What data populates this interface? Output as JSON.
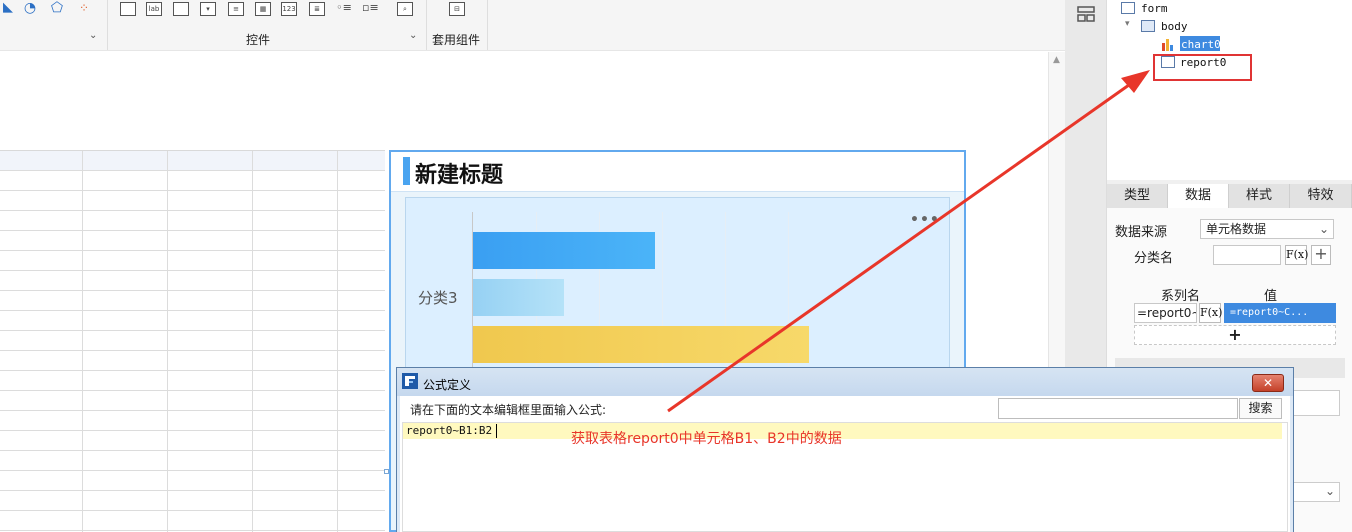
{
  "toolbar": {
    "group_controls_label": "控件",
    "group_common_label": "套用组件",
    "icon_names": [
      "map-chart-icon",
      "gauge-chart-icon",
      "radar-chart-icon",
      "scatter-chart-icon",
      "button-icon",
      "label-icon",
      "textbox-icon",
      "combobox-icon",
      "select-list-icon",
      "date-icon",
      "number-icon",
      "textarea-icon",
      "radio-group-icon",
      "checkbox-group-icon",
      "query-icon",
      "component-icon"
    ]
  },
  "chart": {
    "title": "新建标题",
    "more": "•••",
    "category_label": "分类3"
  },
  "tree": {
    "root": "form",
    "body": "body",
    "chart": "chart0",
    "report": "report0"
  },
  "prop_tabs": [
    "类型",
    "数据",
    "样式",
    "特效"
  ],
  "data_panel": {
    "source_label": "数据来源",
    "source_value": "单元格数据",
    "category_label": "分类名",
    "series_name_header": "系列名",
    "value_header": "值",
    "series_name_value": "=report0~I",
    "value_value": "=report0~C...",
    "fx": "F(x)",
    "add": "+"
  },
  "dialog": {
    "title": "公式定义",
    "prompt": "请在下面的文本编辑框里面输入公式:",
    "search_label": "搜索",
    "search_value": "",
    "formula": "report0~B1:B2",
    "close": "✕"
  },
  "annotation": "获取表格report0中单元格B1、B2中的数据",
  "colors": {
    "accent": "#3e8ae0",
    "bar1": "#3ea8f4",
    "bar2": "#a8dcf6",
    "bar3": "#f2cf56",
    "annotation_red": "#e8362a"
  },
  "chart_data": {
    "type": "bar",
    "orientation": "horizontal",
    "title": "新建标题",
    "categories": [
      "分类3"
    ],
    "series": [
      {
        "values": [
          0.52
        ]
      },
      {
        "values": [
          0.26
        ]
      },
      {
        "values": [
          0.96
        ]
      }
    ]
  }
}
